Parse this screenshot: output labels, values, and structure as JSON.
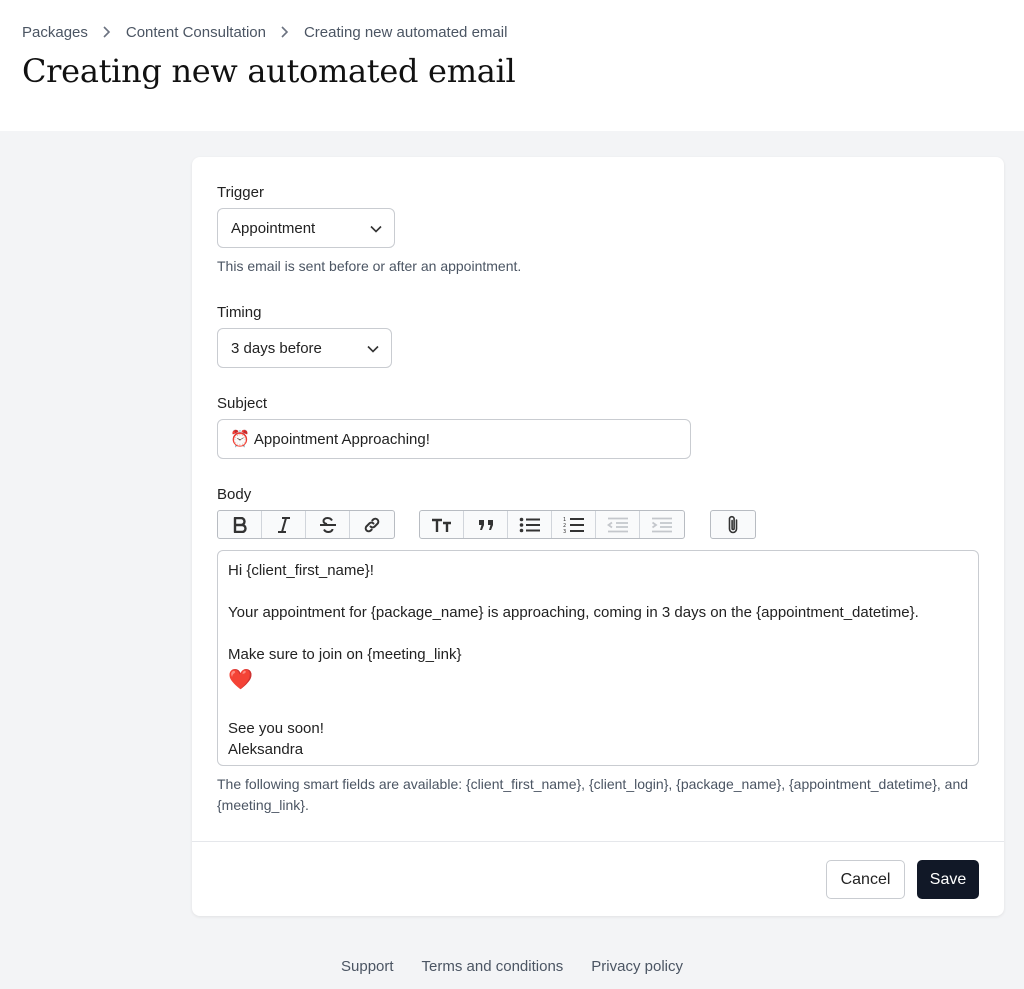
{
  "breadcrumb": {
    "items": [
      "Packages",
      "Content Consultation",
      "Creating new automated email"
    ]
  },
  "page": {
    "title": "Creating new automated email"
  },
  "form": {
    "trigger": {
      "label": "Trigger",
      "value": "Appointment",
      "help": "This email is sent before or after an appointment."
    },
    "timing": {
      "label": "Timing",
      "value": "3 days before"
    },
    "subject": {
      "label": "Subject",
      "emoji": "⏰",
      "value": "Appointment Approaching!"
    },
    "body": {
      "label": "Body",
      "lines": [
        "Hi {client_first_name}!",
        "",
        "Your appointment for {package_name} is approaching, coming in 3 days on the {appointment_datetime}.",
        "",
        "Make sure to join on {meeting_link}",
        "❤️",
        "",
        "See you soon!",
        "Aleksandra"
      ]
    },
    "smart_fields_note": "The following smart fields are available: {client_first_name}, {client_login}, {package_name}, {appointment_datetime}, and {meeting_link}."
  },
  "toolbar": {
    "groups": [
      [
        "bold-icon",
        "italic-icon",
        "strikethrough-icon",
        "link-icon"
      ],
      [
        "heading-icon",
        "quote-icon",
        "bullet-list-icon",
        "numbered-list-icon",
        "outdent-icon",
        "indent-icon"
      ],
      [
        "attachment-icon"
      ]
    ]
  },
  "actions": {
    "cancel_label": "Cancel",
    "save_label": "Save"
  },
  "footer": {
    "links": [
      "Support",
      "Terms and conditions",
      "Privacy policy"
    ]
  },
  "colors": {
    "primary_button": "#111827",
    "background": "#f3f4f6"
  }
}
